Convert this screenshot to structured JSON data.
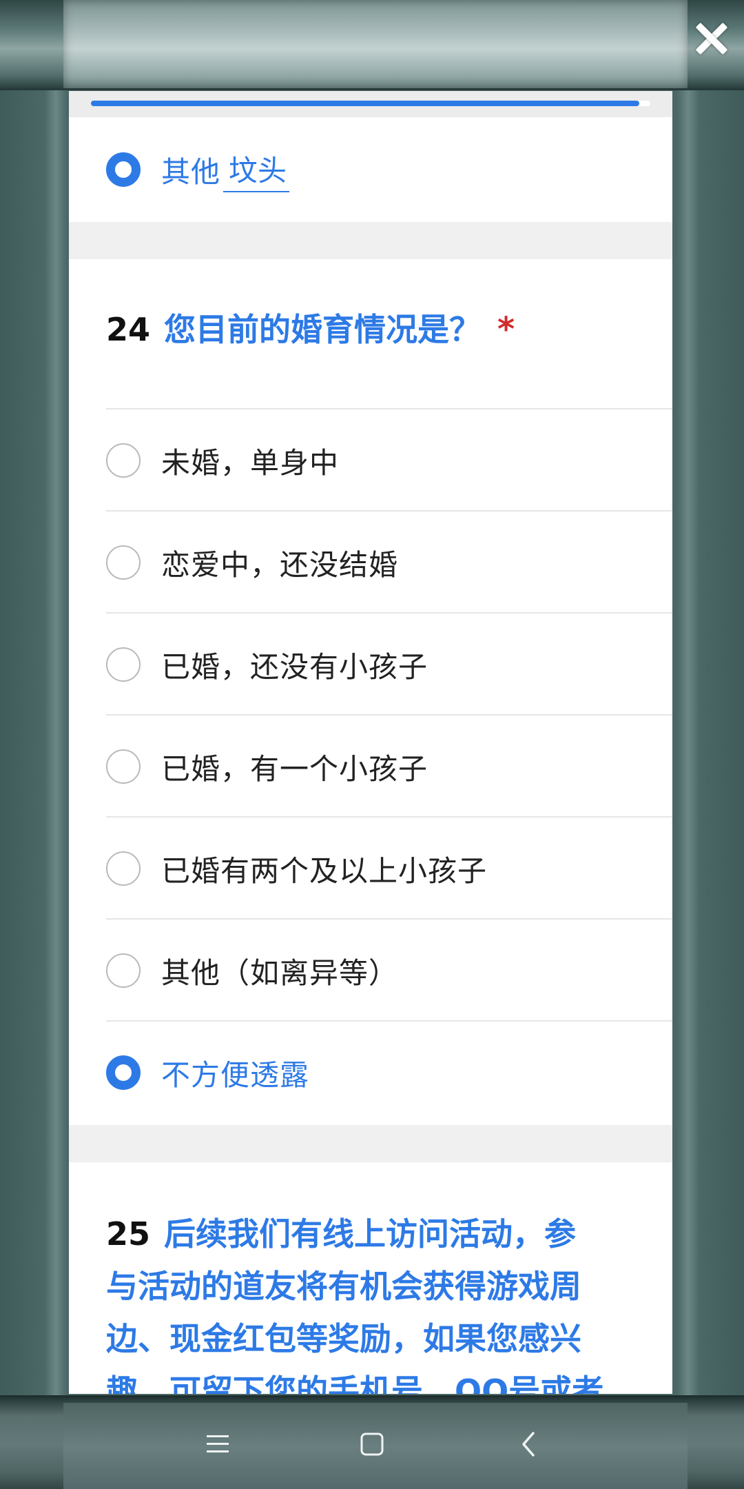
{
  "progress": {
    "fraction": 0.98
  },
  "previous_question": {
    "selected_option_label": "其他",
    "other_input_value": "坟头"
  },
  "question_24": {
    "number": "24",
    "title": "您目前的婚育情况是？",
    "required_mark": "*",
    "options": [
      {
        "label": "未婚，单身中",
        "selected": false
      },
      {
        "label": "恋爱中，还没结婚",
        "selected": false
      },
      {
        "label": "已婚，还没有小孩子",
        "selected": false
      },
      {
        "label": "已婚，有一个小孩子",
        "selected": false
      },
      {
        "label": "已婚有两个及以上小孩子",
        "selected": false
      },
      {
        "label": "其他（如离异等）",
        "selected": false
      },
      {
        "label": "不方便透露",
        "selected": true
      }
    ]
  },
  "question_25": {
    "number": "25",
    "title_lines": [
      "后续我们有线上访问活动，参",
      "与活动的道友将有机会获得游戏周",
      "边、现金红包等奖励，如果您感兴",
      "趣，可留下您的手机号，QQ号或者"
    ]
  },
  "icons": {
    "close": "close-icon",
    "menu": "menu-icon",
    "home": "home-square-icon",
    "back": "back-chevron-icon"
  },
  "colors": {
    "accent": "#2d7ae6",
    "required": "#d22c2c"
  }
}
